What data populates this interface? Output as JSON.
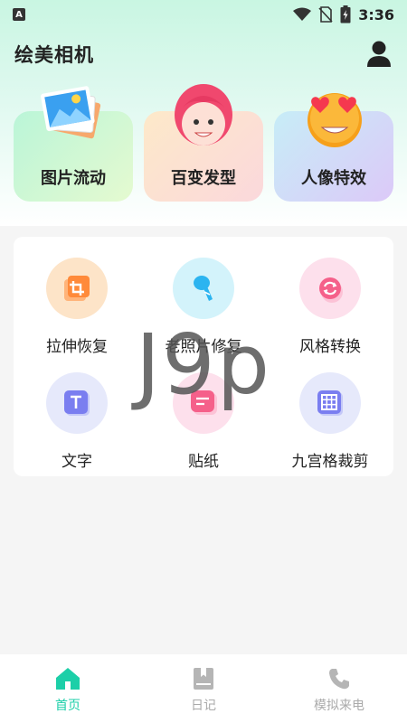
{
  "status_bar": {
    "time": "3:36",
    "notification_icon": "A"
  },
  "header": {
    "title": "绘美相机"
  },
  "features": [
    {
      "label": "图片流动",
      "icon": "picture-flow-icon"
    },
    {
      "label": "百变发型",
      "icon": "hairstyle-avatar-icon"
    },
    {
      "label": "人像特效",
      "icon": "heart-eyes-emoji-icon"
    }
  ],
  "tools": [
    {
      "label": "拉伸恢复",
      "icon": "crop-icon"
    },
    {
      "label": "老照片修复",
      "icon": "brush-icon"
    },
    {
      "label": "风格转换",
      "icon": "convert-icon"
    },
    {
      "label": "文字",
      "icon": "text-icon"
    },
    {
      "label": "贴纸",
      "icon": "sticker-icon"
    },
    {
      "label": "九宫格裁剪",
      "icon": "grid-icon"
    }
  ],
  "watermark": "J9p",
  "bottom_nav": [
    {
      "label": "首页",
      "active": true
    },
    {
      "label": "日记",
      "active": false
    },
    {
      "label": "模拟来电",
      "active": false
    }
  ],
  "colors": {
    "accent": "#1ccfa8",
    "inactive": "#aaaaaa"
  }
}
